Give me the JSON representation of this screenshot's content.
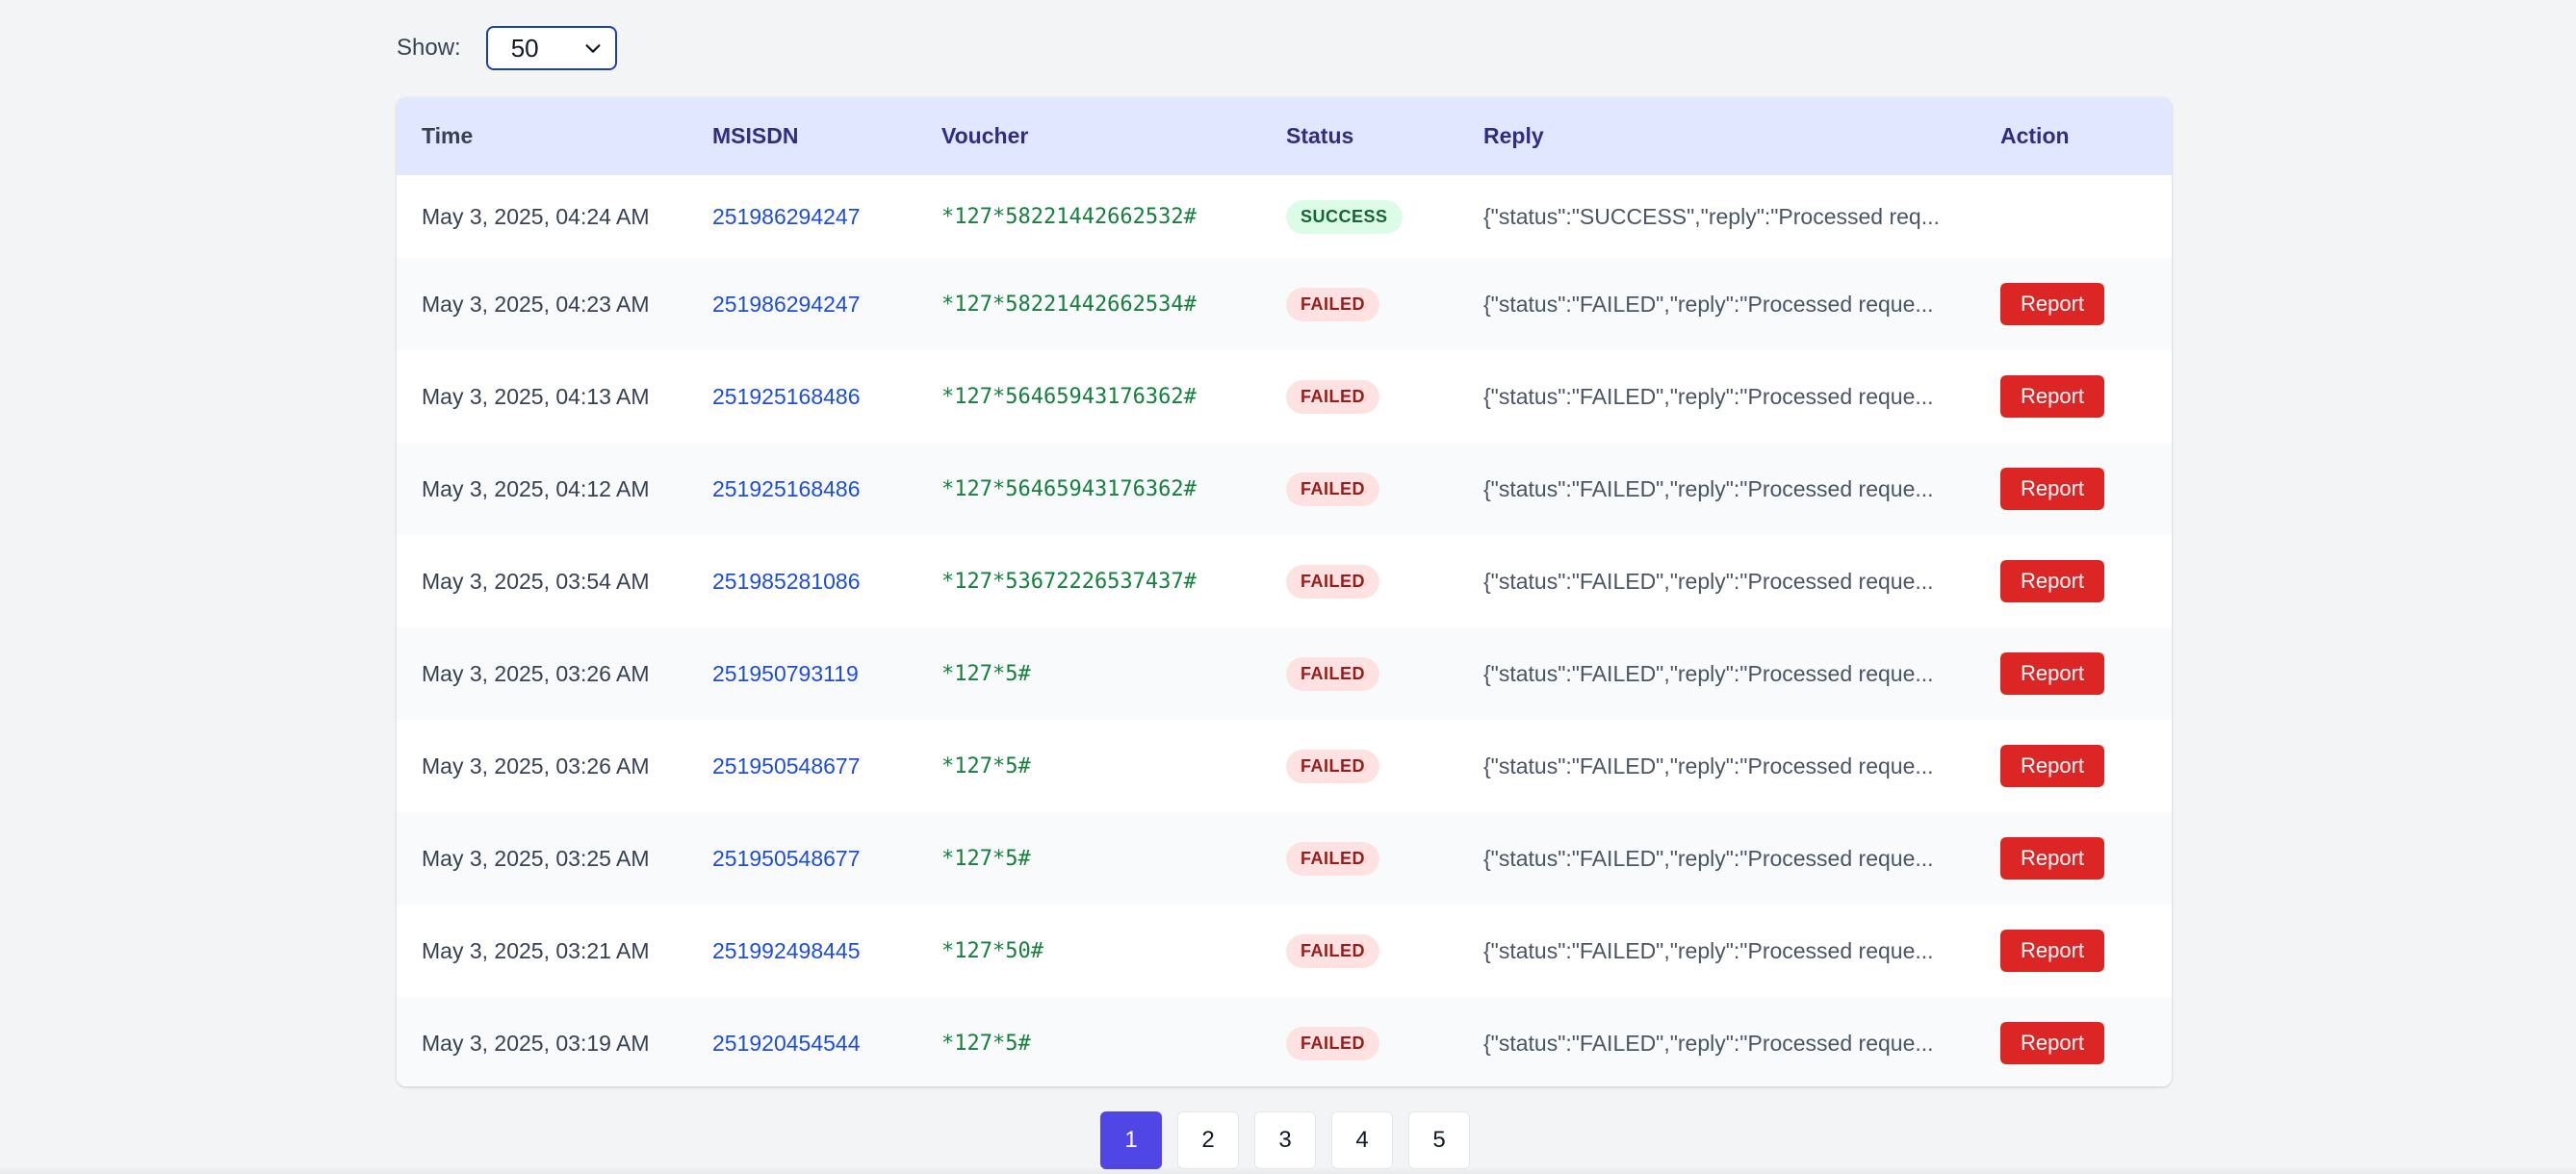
{
  "page_size": {
    "label": "Show:",
    "value": "50"
  },
  "table": {
    "headers": {
      "time": "Time",
      "msisdn": "MSISDN",
      "voucher": "Voucher",
      "status": "Status",
      "reply": "Reply",
      "action": "Action"
    },
    "rows": [
      {
        "time": "May 3, 2025, 04:24 AM",
        "msisdn": "251986294247",
        "voucher": "*127*58221442662532#",
        "status": "SUCCESS",
        "reply": "{\"status\":\"SUCCESS\",\"reply\":\"Processed req...",
        "action": ""
      },
      {
        "time": "May 3, 2025, 04:23 AM",
        "msisdn": "251986294247",
        "voucher": "*127*58221442662534#",
        "status": "FAILED",
        "reply": "{\"status\":\"FAILED\",\"reply\":\"Processed reque...",
        "action": "Report"
      },
      {
        "time": "May 3, 2025, 04:13 AM",
        "msisdn": "251925168486",
        "voucher": "*127*56465943176362#",
        "status": "FAILED",
        "reply": "{\"status\":\"FAILED\",\"reply\":\"Processed reque...",
        "action": "Report"
      },
      {
        "time": "May 3, 2025, 04:12 AM",
        "msisdn": "251925168486",
        "voucher": "*127*56465943176362#",
        "status": "FAILED",
        "reply": "{\"status\":\"FAILED\",\"reply\":\"Processed reque...",
        "action": "Report"
      },
      {
        "time": "May 3, 2025, 03:54 AM",
        "msisdn": "251985281086",
        "voucher": "*127*53672226537437#",
        "status": "FAILED",
        "reply": "{\"status\":\"FAILED\",\"reply\":\"Processed reque...",
        "action": "Report"
      },
      {
        "time": "May 3, 2025, 03:26 AM",
        "msisdn": "251950793119",
        "voucher": "*127*5#",
        "status": "FAILED",
        "reply": "{\"status\":\"FAILED\",\"reply\":\"Processed reque...",
        "action": "Report"
      },
      {
        "time": "May 3, 2025, 03:26 AM",
        "msisdn": "251950548677",
        "voucher": "*127*5#",
        "status": "FAILED",
        "reply": "{\"status\":\"FAILED\",\"reply\":\"Processed reque...",
        "action": "Report"
      },
      {
        "time": "May 3, 2025, 03:25 AM",
        "msisdn": "251950548677",
        "voucher": "*127*5#",
        "status": "FAILED",
        "reply": "{\"status\":\"FAILED\",\"reply\":\"Processed reque...",
        "action": "Report"
      },
      {
        "time": "May 3, 2025, 03:21 AM",
        "msisdn": "251992498445",
        "voucher": "*127*50#",
        "status": "FAILED",
        "reply": "{\"status\":\"FAILED\",\"reply\":\"Processed reque...",
        "action": "Report"
      },
      {
        "time": "May 3, 2025, 03:19 AM",
        "msisdn": "251920454544",
        "voucher": "*127*5#",
        "status": "FAILED",
        "reply": "{\"status\":\"FAILED\",\"reply\":\"Processed reque...",
        "action": "Report"
      }
    ]
  },
  "pagination": {
    "pages": [
      "1",
      "2",
      "3",
      "4",
      "5"
    ],
    "current": "1"
  },
  "colors": {
    "header_bg": "#e0e7ff",
    "header_text": "#312e81",
    "msisdn": "#1d4ed8",
    "voucher": "#15803d",
    "report_button": "#dc2626",
    "active_page": "#4f46e5"
  }
}
